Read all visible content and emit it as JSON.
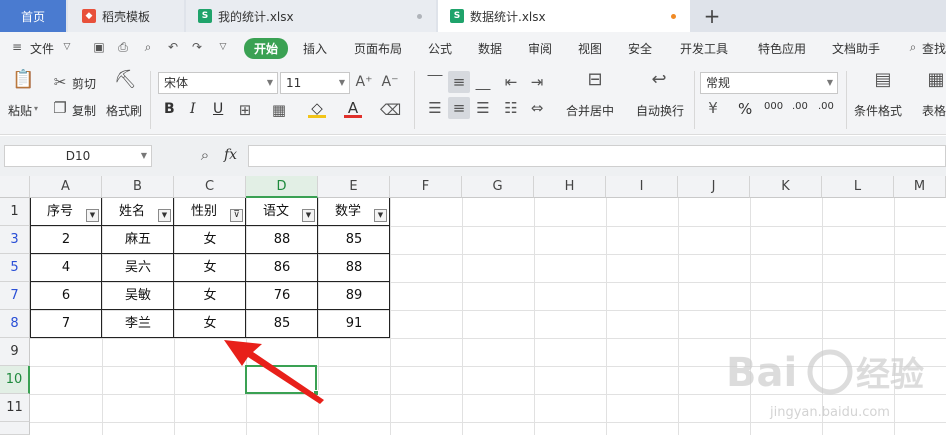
{
  "tabs": {
    "home": "首页",
    "t1": "稻壳模板",
    "t2": "我的统计.xlsx",
    "t3": "数据统计.xlsx",
    "t2_icon": "S",
    "t3_icon": "S",
    "accent": "#4a7bd0",
    "unsaved_dot_color": "#f08a24"
  },
  "menu": {
    "file": "文件",
    "start": "开始",
    "insert": "插入",
    "layout": "页面布局",
    "formula": "公式",
    "data": "数据",
    "review": "审阅",
    "view": "视图",
    "security": "安全",
    "dev": "开发工具",
    "special": "特色应用",
    "helper": "文档助手",
    "search": "查找"
  },
  "ribbon": {
    "paste": "粘贴",
    "cut": "剪切",
    "copy": "复制",
    "format_painter": "格式刷",
    "font_name": "宋体",
    "font_size": "11",
    "bold": "B",
    "italic": "I",
    "underline": "U",
    "merge_center": "合并居中",
    "wrap_text": "自动换行",
    "number_format": "常规",
    "conditional_format": "条件格式",
    "table_style": "表格",
    "percent": "%",
    "thousand": "000",
    "dec_inc": ".00",
    "dec_dec": ".00"
  },
  "formula_bar": {
    "name_box": "D10",
    "fx": "fx",
    "value": ""
  },
  "sheet": {
    "columns": [
      "A",
      "B",
      "C",
      "D",
      "E",
      "F",
      "G",
      "H",
      "I",
      "J",
      "K",
      "L",
      "M"
    ],
    "rows": [
      "1",
      "3",
      "5",
      "7",
      "8",
      "9",
      "10",
      "11"
    ],
    "header_row": [
      "序号",
      "姓名",
      "性别",
      "语文",
      "数学"
    ],
    "data_rows": [
      [
        "2",
        "麻五",
        "女",
        "88",
        "85"
      ],
      [
        "4",
        "吴六",
        "女",
        "86",
        "88"
      ],
      [
        "6",
        "吴敏",
        "女",
        "76",
        "89"
      ],
      [
        "7",
        "李兰",
        "女",
        "85",
        "91"
      ]
    ],
    "selected_cell": "D10"
  },
  "watermark": {
    "text1": "Bai",
    "text2": "经验",
    "text3": "jingyan.baidu.com"
  }
}
